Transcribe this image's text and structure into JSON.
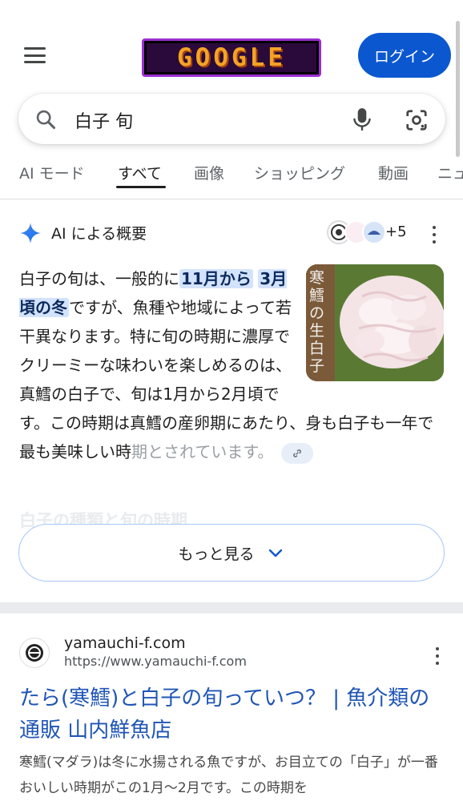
{
  "header": {
    "menu_icon": "hamburger-menu-icon",
    "doodle_text": "GOOGLE",
    "login_label": "ログイン",
    "login_color": "#0b57d0"
  },
  "search": {
    "query": "白子 旬",
    "search_icon": "search-icon",
    "mic_icon": "microphone-icon",
    "lens_icon": "google-lens-icon"
  },
  "tabs": {
    "items": [
      "AI モード",
      "すべて",
      "画像",
      "ショッピング",
      "動画",
      "ニュ"
    ],
    "active": "すべて"
  },
  "ai_overview": {
    "title": "AI による概要",
    "sources_more": "+5",
    "image_caption": "寒鱈の生白子",
    "text_part1": "白子の旬は、一般的に",
    "highlight1": "11月から",
    "highlight2": "3月頃の冬",
    "text_part2": "ですが、魚種や地域によって若干異なります。特に旬の時期に濃厚でクリーミーな味わいを楽しめるのは、真鱈の白子で、旬は1月から2月頃です。この時期は真鱈の産卵期にあたり、身も白子も一年で最も美味しい時",
    "text_faded": "期とされています。",
    "hidden_heading": "白子の種類と旬の時期",
    "more_label": "もっと見る"
  },
  "result": {
    "site_name": "yamauchi-f.com",
    "site_url": "https://www.yamauchi-f.com",
    "title": "たら(寒鱈)と白子の旬っていつ？ | 魚介類の通販 山内鮮魚店",
    "snippet": "寒鱈(マダラ)は冬に水揚される魚ですが、お目立ての「白子」が一番おいしい時期がこの1月〜2月です。この時期を"
  }
}
